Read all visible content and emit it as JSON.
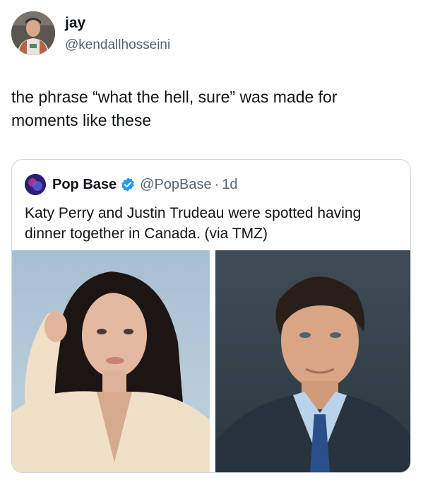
{
  "author": {
    "display_name": "jay",
    "handle": "@kendallhosseini"
  },
  "tweet": {
    "text": "the phrase “what the hell, sure” was made for moments like these"
  },
  "quoted_tweet": {
    "display_name": "Pop Base",
    "handle": "@PopBase",
    "separator": "·",
    "time": "1d",
    "text": "Katy Perry and Justin Trudeau were spotted having dinner together in Canada. (via TMZ)"
  },
  "icons": {
    "verified": "verified-badge-icon"
  },
  "colors": {
    "text": "#0f1419",
    "secondary": "#536471",
    "verified": "#1d9bf0",
    "border": "#cfd9de"
  }
}
